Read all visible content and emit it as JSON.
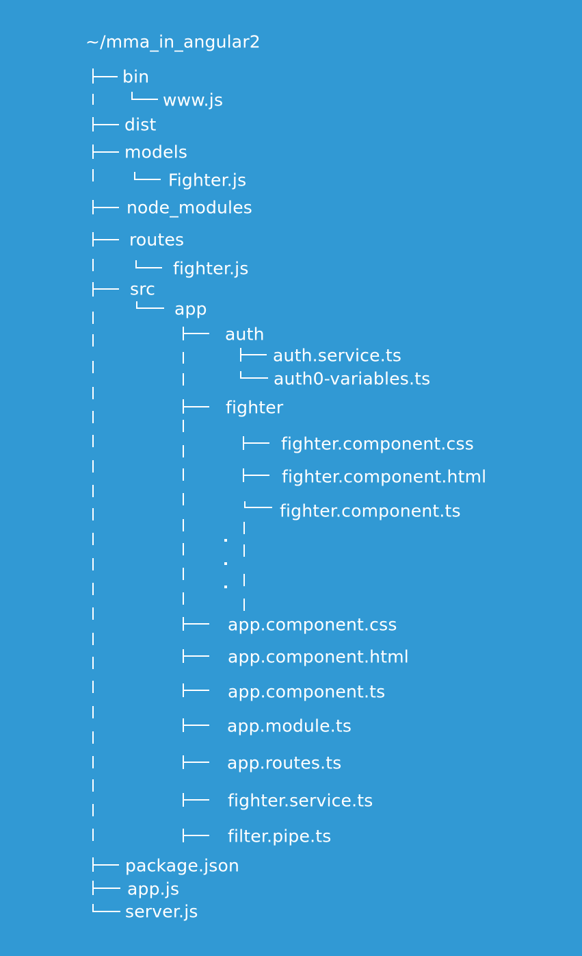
{
  "root": "~/mma_in_angular2",
  "tree": {
    "bin": "bin",
    "www_js": "www.js",
    "dist": "dist",
    "models": "models",
    "fighter_js_model": "Fighter.js",
    "node_modules": "node_modules",
    "routes": "routes",
    "fighter_js_route": "fighter.js",
    "src": "src",
    "app": "app",
    "auth": "auth",
    "auth_service": "auth.service.ts",
    "auth0_variables": "auth0-variables.ts",
    "fighter": "fighter",
    "fighter_css": "fighter.component.css",
    "fighter_html": "fighter.component.html",
    "fighter_ts": "fighter.component.ts",
    "app_css": "app.component.css",
    "app_html": "app.component.html",
    "app_ts": "app.component.ts",
    "app_module": "app.module.ts",
    "app_routes": "app.routes.ts",
    "fighter_service": "fighter.service.ts",
    "filter_pipe": "filter.pipe.ts",
    "package_json": "package.json",
    "app_js": "app.js",
    "server_js": "server.js"
  }
}
